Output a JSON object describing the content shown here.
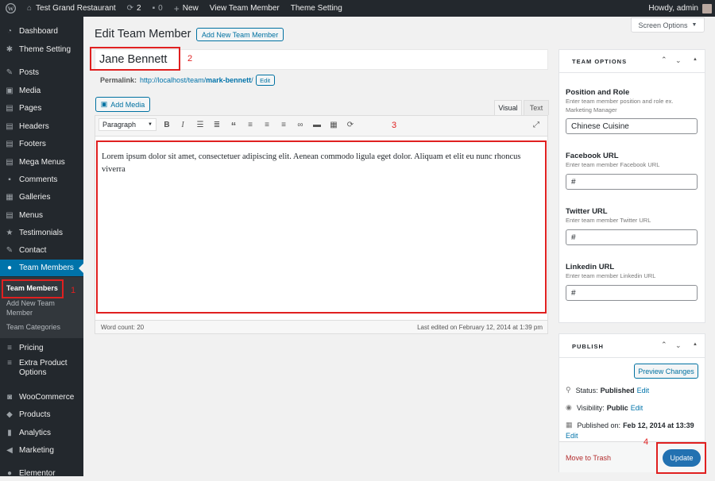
{
  "adminbar": {
    "site_name": "Test Grand Restaurant",
    "updates_count": "2",
    "comments_count": "0",
    "new_label": "New",
    "view_label": "View Team Member",
    "theme_setting": "Theme Setting",
    "howdy": "Howdy, admin"
  },
  "sidebar": {
    "items": [
      {
        "label": "Dashboard",
        "icon": "dashboard-icon"
      },
      {
        "label": "Theme Setting",
        "icon": "gear-icon"
      },
      {
        "label": "Posts",
        "icon": "pin-icon"
      },
      {
        "label": "Media",
        "icon": "media-icon"
      },
      {
        "label": "Pages",
        "icon": "pages-icon"
      },
      {
        "label": "Headers",
        "icon": "pages-icon"
      },
      {
        "label": "Footers",
        "icon": "pages-icon"
      },
      {
        "label": "Mega Menus",
        "icon": "pages-icon"
      },
      {
        "label": "Comments",
        "icon": "comment-icon"
      },
      {
        "label": "Galleries",
        "icon": "gallery-icon"
      },
      {
        "label": "Menus",
        "icon": "pages-icon"
      },
      {
        "label": "Testimonials",
        "icon": "star-icon"
      },
      {
        "label": "Contact",
        "icon": "pin-icon"
      },
      {
        "label": "Team Members",
        "icon": "users-icon"
      }
    ],
    "submenu": [
      "Team Members",
      "Add New Team Member",
      "Team Categories"
    ],
    "lower_items": [
      {
        "label": "Pricing",
        "icon": "list-icon"
      },
      {
        "label": "Extra Product Options",
        "icon": "list-icon"
      },
      {
        "label": "WooCommerce",
        "icon": "woo-icon"
      },
      {
        "label": "Products",
        "icon": "box-icon"
      },
      {
        "label": "Analytics",
        "icon": "chart-icon"
      },
      {
        "label": "Marketing",
        "icon": "megaphone-icon"
      },
      {
        "label": "Elementor",
        "icon": "elementor-icon"
      }
    ]
  },
  "annotations": [
    "1",
    "2",
    "3",
    "4"
  ],
  "screen_options": "Screen Options",
  "page": {
    "title": "Edit Team Member",
    "add_new": "Add New Team Member",
    "post_title": "Jane Bennett",
    "permalink_label": "Permalink:",
    "permalink_base": "http://localhost/team/",
    "permalink_slug": "mark-bennett",
    "permalink_trail": "/",
    "permalink_edit": "Edit"
  },
  "editor": {
    "add_media": "Add Media",
    "tab_visual": "Visual",
    "tab_text": "Text",
    "format": "Paragraph",
    "content": "Lorem ipsum dolor sit amet, consectetuer adipiscing elit. Aenean commodo ligula eget dolor. Aliquam et elit eu nunc rhoncus viverra",
    "word_count": "Word count: 20",
    "last_edited": "Last edited on February 12, 2014 at 1:39 pm"
  },
  "team_options": {
    "heading": "TEAM OPTIONS",
    "fields": [
      {
        "label": "Position and Role",
        "desc": "Enter team member position and role ex. Marketing Manager",
        "value": "Chinese Cuisine"
      },
      {
        "label": "Facebook URL",
        "desc": "Enter team member Facebook URL",
        "value": "#"
      },
      {
        "label": "Twitter URL",
        "desc": "Enter team member Twitter URL",
        "value": "#"
      },
      {
        "label": "Linkedin URL",
        "desc": "Enter team member Linkedin URL",
        "value": "#"
      }
    ]
  },
  "publish": {
    "heading": "PUBLISH",
    "preview": "Preview Changes",
    "status_label": "Status:",
    "status_value": "Published",
    "visibility_label": "Visibility:",
    "visibility_value": "Public",
    "published_label": "Published on:",
    "published_value": "Feb 12, 2014 at 13:39",
    "edit": "Edit",
    "trash": "Move to Trash",
    "update": "Update"
  },
  "colors": {
    "accent": "#0073aa",
    "sidebar": "#23282d",
    "annotation": "#e02020",
    "update_button": "#2271b1"
  }
}
